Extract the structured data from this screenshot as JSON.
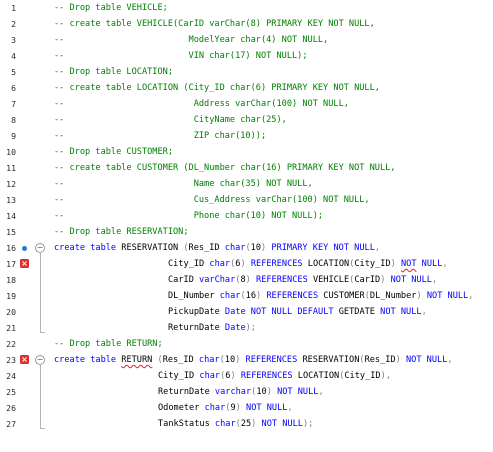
{
  "editor": {
    "lines": [
      {
        "n": "1",
        "t": [
          [
            "c",
            "-- Drop table VEHICLE;"
          ]
        ]
      },
      {
        "n": "2",
        "t": [
          [
            "c",
            "-- create table VEHICLE(CarID varChar(8) PRIMARY KEY NOT NULL,"
          ]
        ]
      },
      {
        "n": "3",
        "t": [
          [
            "c",
            "--                        ModelYear char(4) NOT NULL,"
          ]
        ]
      },
      {
        "n": "4",
        "t": [
          [
            "c",
            "--                        VIN char(17) NOT NULL);"
          ]
        ]
      },
      {
        "n": "5",
        "t": [
          [
            "c",
            "-- Drop table LOCATION;"
          ]
        ]
      },
      {
        "n": "6",
        "t": [
          [
            "c",
            "-- create table LOCATION (City_ID char(6) PRIMARY KEY NOT NULL,"
          ]
        ]
      },
      {
        "n": "7",
        "t": [
          [
            "c",
            "--                         Address varChar(100) NOT NULL,"
          ]
        ]
      },
      {
        "n": "8",
        "t": [
          [
            "c",
            "--                         CityName char(25),"
          ]
        ]
      },
      {
        "n": "9",
        "t": [
          [
            "c",
            "--                         ZIP char(10));"
          ]
        ]
      },
      {
        "n": "10",
        "t": [
          [
            "c",
            "-- Drop table CUSTOMER;"
          ]
        ]
      },
      {
        "n": "11",
        "t": [
          [
            "c",
            "-- create table CUSTOMER (DL_Number char(16) PRIMARY KEY NOT NULL,"
          ]
        ]
      },
      {
        "n": "12",
        "t": [
          [
            "c",
            "--                         Name char(35) NOT NULL,"
          ]
        ]
      },
      {
        "n": "13",
        "t": [
          [
            "c",
            "--                         Cus_Address varChar(100) NOT NULL,"
          ]
        ]
      },
      {
        "n": "14",
        "t": [
          [
            "c",
            "--                         Phone char(10) NOT NULL);"
          ]
        ]
      },
      {
        "n": "15",
        "t": [
          [
            "c",
            "-- Drop table RESERVATION;"
          ]
        ]
      },
      {
        "n": "16",
        "t": [
          [
            "k",
            "create table "
          ],
          [
            "x",
            "RESERVATION "
          ],
          [
            "g",
            "("
          ],
          [
            "x",
            "Res_ID "
          ],
          [
            "k",
            "char"
          ],
          [
            "g",
            "("
          ],
          [
            "x",
            "10"
          ],
          [
            "g",
            ")"
          ],
          [
            "x",
            " "
          ],
          [
            "k",
            "PRIMARY KEY NOT NULL"
          ],
          [
            "g",
            ","
          ]
        ]
      },
      {
        "n": "17",
        "t": [
          [
            "x",
            "City_ID "
          ],
          [
            "k",
            "char"
          ],
          [
            "g",
            "("
          ],
          [
            "x",
            "6"
          ],
          [
            "g",
            ")"
          ],
          [
            "x",
            " "
          ],
          [
            "k",
            "REFERENCES "
          ],
          [
            "x",
            "LOCATION"
          ],
          [
            "g",
            "("
          ],
          [
            "x",
            "City_ID"
          ],
          [
            "g",
            ")"
          ],
          [
            "x",
            " "
          ],
          [
            "ks",
            "NOT"
          ],
          [
            "k",
            " NULL"
          ],
          [
            "g",
            ","
          ]
        ]
      },
      {
        "n": "18",
        "t": [
          [
            "x",
            "CarID "
          ],
          [
            "k",
            "varChar"
          ],
          [
            "g",
            "("
          ],
          [
            "x",
            "8"
          ],
          [
            "g",
            ")"
          ],
          [
            "x",
            " "
          ],
          [
            "k",
            "REFERENCES "
          ],
          [
            "x",
            "VEHICLE"
          ],
          [
            "g",
            "("
          ],
          [
            "x",
            "CarID"
          ],
          [
            "g",
            ")"
          ],
          [
            "x",
            " "
          ],
          [
            "k",
            "NOT NULL"
          ],
          [
            "g",
            ","
          ]
        ]
      },
      {
        "n": "19",
        "t": [
          [
            "x",
            "DL_Number "
          ],
          [
            "k",
            "char"
          ],
          [
            "g",
            "("
          ],
          [
            "x",
            "16"
          ],
          [
            "g",
            ")"
          ],
          [
            "x",
            " "
          ],
          [
            "k",
            "REFERENCES "
          ],
          [
            "x",
            "CUSTOMER"
          ],
          [
            "g",
            "("
          ],
          [
            "x",
            "DL_Number"
          ],
          [
            "g",
            ")"
          ],
          [
            "x",
            " "
          ],
          [
            "k",
            "NOT NULL"
          ],
          [
            "g",
            ","
          ]
        ]
      },
      {
        "n": "20",
        "t": [
          [
            "x",
            "PickupDate "
          ],
          [
            "k",
            "Date NOT NULL DEFAULT "
          ],
          [
            "x",
            "GETDATE "
          ],
          [
            "k",
            "NOT NULL"
          ],
          [
            "g",
            ","
          ]
        ]
      },
      {
        "n": "21",
        "t": [
          [
            "x",
            "ReturnDate "
          ],
          [
            "k",
            "Date"
          ],
          [
            "g",
            ");"
          ]
        ]
      },
      {
        "n": "22",
        "t": [
          [
            "c",
            "-- Drop table RETURN;"
          ]
        ]
      },
      {
        "n": "23",
        "t": [
          [
            "k",
            "create table "
          ],
          [
            "xs",
            "RETURN"
          ],
          [
            "x",
            " "
          ],
          [
            "g",
            "("
          ],
          [
            "x",
            "Res_ID "
          ],
          [
            "k",
            "char"
          ],
          [
            "g",
            "("
          ],
          [
            "x",
            "10"
          ],
          [
            "g",
            ")"
          ],
          [
            "x",
            " "
          ],
          [
            "k",
            "REFERENCES "
          ],
          [
            "x",
            "RESERVATION"
          ],
          [
            "g",
            "("
          ],
          [
            "x",
            "Res_ID"
          ],
          [
            "g",
            ")"
          ],
          [
            "x",
            " "
          ],
          [
            "k",
            "NOT NULL"
          ],
          [
            "g",
            ","
          ]
        ]
      },
      {
        "n": "24",
        "t": [
          [
            "x",
            "City_ID "
          ],
          [
            "k",
            "char"
          ],
          [
            "g",
            "("
          ],
          [
            "x",
            "6"
          ],
          [
            "g",
            ")"
          ],
          [
            "x",
            " "
          ],
          [
            "k",
            "REFERENCES "
          ],
          [
            "x",
            "LOCATION"
          ],
          [
            "g",
            "("
          ],
          [
            "x",
            "City_ID"
          ],
          [
            "g",
            "),"
          ]
        ]
      },
      {
        "n": "25",
        "t": [
          [
            "x",
            "ReturnDate "
          ],
          [
            "k",
            "varchar"
          ],
          [
            "g",
            "("
          ],
          [
            "x",
            "10"
          ],
          [
            "g",
            ")"
          ],
          [
            "x",
            " "
          ],
          [
            "k",
            "NOT NULL"
          ],
          [
            "g",
            ","
          ]
        ]
      },
      {
        "n": "26",
        "t": [
          [
            "x",
            "Odometer "
          ],
          [
            "k",
            "char"
          ],
          [
            "g",
            "("
          ],
          [
            "x",
            "9"
          ],
          [
            "g",
            ")"
          ],
          [
            "x",
            " "
          ],
          [
            "k",
            "NOT NULL"
          ],
          [
            "g",
            ","
          ]
        ]
      },
      {
        "n": "27",
        "t": [
          [
            "x",
            "TankStatus "
          ],
          [
            "k",
            "char"
          ],
          [
            "g",
            "("
          ],
          [
            "x",
            "25"
          ],
          [
            "g",
            ")"
          ],
          [
            "x",
            " "
          ],
          [
            "k",
            "NOT NULL"
          ],
          [
            "g",
            ");"
          ]
        ]
      }
    ],
    "markers": {
      "16": {
        "breakpoint": true,
        "fold": "⊖"
      },
      "17": {
        "error": "×"
      },
      "23": {
        "error": "×",
        "fold": "⊖"
      }
    },
    "colors": {
      "comment": "#008000",
      "keyword": "#0000ff",
      "punctuation": "#808080",
      "error": "#d1342f",
      "breakpoint": "#1e78d7"
    }
  }
}
